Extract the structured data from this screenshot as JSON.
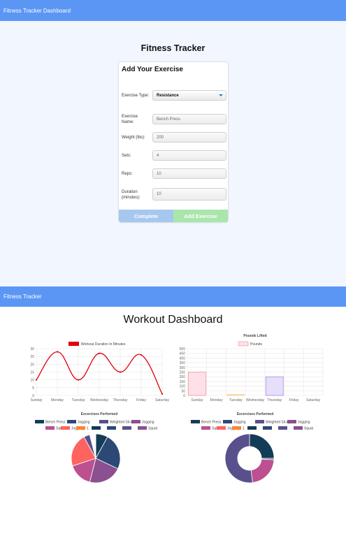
{
  "nav_top": {
    "brand": "Fitness Tracker Dashboard"
  },
  "form": {
    "page_title": "Fitness Tracker",
    "card_title": "Add Your Exercise",
    "type_label": "Exercise Type:",
    "type_value": "Resistance",
    "name_label": "Exercise Name:",
    "name_placeholder": "Bench Press",
    "weight_label": "Weight (lbs):",
    "weight_placeholder": "200",
    "sets_label": "Sets:",
    "sets_placeholder": "4",
    "reps_label": "Reps:",
    "reps_placeholder": "10",
    "duration_label": "Duration (minutes):",
    "duration_placeholder": "10",
    "complete_label": "Complete",
    "add_label": "Add Exercise"
  },
  "nav_bottom": {
    "brand": "Fitness Tracker"
  },
  "dashboard": {
    "title": "Workout Dashboard"
  },
  "chart_data": [
    {
      "type": "line",
      "title": "",
      "categories": [
        "Sunday",
        "Monday",
        "Tuesday",
        "Wednesday",
        "Thursday",
        "Friday",
        "Saturday"
      ],
      "series": [
        {
          "name": "Workout Duration In Minutes",
          "values": [
            10,
            28,
            10,
            27,
            15,
            26,
            1
          ],
          "color": "#e0000b"
        }
      ],
      "ylim": [
        0,
        30
      ],
      "yticks": [
        0,
        5,
        10,
        15,
        20,
        25,
        30
      ],
      "legend": "top",
      "grid": true
    },
    {
      "type": "bar",
      "title": "Pounds Lifted",
      "categories": [
        "Sunday",
        "Monday",
        "Tuesday",
        "Wednesday",
        "Thursday",
        "Friday",
        "Saturday"
      ],
      "series": [
        {
          "name": "Pounds",
          "values": [
            250,
            0,
            10,
            0,
            200,
            0,
            0
          ]
        }
      ],
      "fills": [
        "#fde1e6",
        "#fde1e6",
        "#fff1d6",
        "#fde1e6",
        "#e7defa",
        "#fde1e6",
        "#fde1e6"
      ],
      "strokes": [
        "#f2899c",
        "#f2899c",
        "#f2c270",
        "#f2899c",
        "#9b82e0",
        "#f2899c",
        "#f2899c"
      ],
      "ylim": [
        0,
        500
      ],
      "yticks": [
        0,
        50,
        100,
        150,
        200,
        250,
        300,
        350,
        400,
        450,
        500
      ],
      "legend": "top",
      "grid": true
    },
    {
      "type": "pie",
      "title": "Excercises Performed",
      "labels": [
        "Bench Press",
        "Jogging",
        "Weighted Sit-ups",
        "Jogging",
        "Squat",
        "Jogging",
        "1",
        "",
        "",
        "",
        "Squat"
      ],
      "legend_colors": [
        "#133c55",
        "#2c4875",
        "#58508d",
        "#8a508f",
        "#bc5090",
        "#ff6361",
        "#ff8531",
        "#133c55",
        "#2c4875",
        "#58508d",
        "#8a508f"
      ],
      "slices": [
        {
          "value": 8,
          "color": "#133c55"
        },
        {
          "value": 24,
          "color": "#2c4875"
        },
        {
          "value": 22,
          "color": "#8a508f"
        },
        {
          "value": 16,
          "color": "#bc5090"
        },
        {
          "value": 22,
          "color": "#ff6361"
        },
        {
          "value": 4,
          "color": "#58508d"
        },
        {
          "value": 4,
          "color": "#ffffff"
        }
      ],
      "legend": "top"
    },
    {
      "type": "pie",
      "donut": true,
      "title": "Excercises Performed",
      "labels": [
        "Bench Press",
        "Jogging",
        "Weighted Sit-ups",
        "Jogging",
        "Squat",
        "Jogging",
        "1",
        "",
        "",
        "",
        "Squat"
      ],
      "legend_colors": [
        "#133c55",
        "#2c4875",
        "#58508d",
        "#8a508f",
        "#bc5090",
        "#ff6361",
        "#ff8531",
        "#133c55",
        "#2c4875",
        "#58508d",
        "#8a508f"
      ],
      "slices": [
        {
          "value": 25,
          "color": "#133c55"
        },
        {
          "value": 1,
          "color": "#5b5a7f"
        },
        {
          "value": 22,
          "color": "#bc5090"
        },
        {
          "value": 52,
          "color": "#58508d"
        }
      ],
      "legend": "top"
    }
  ]
}
